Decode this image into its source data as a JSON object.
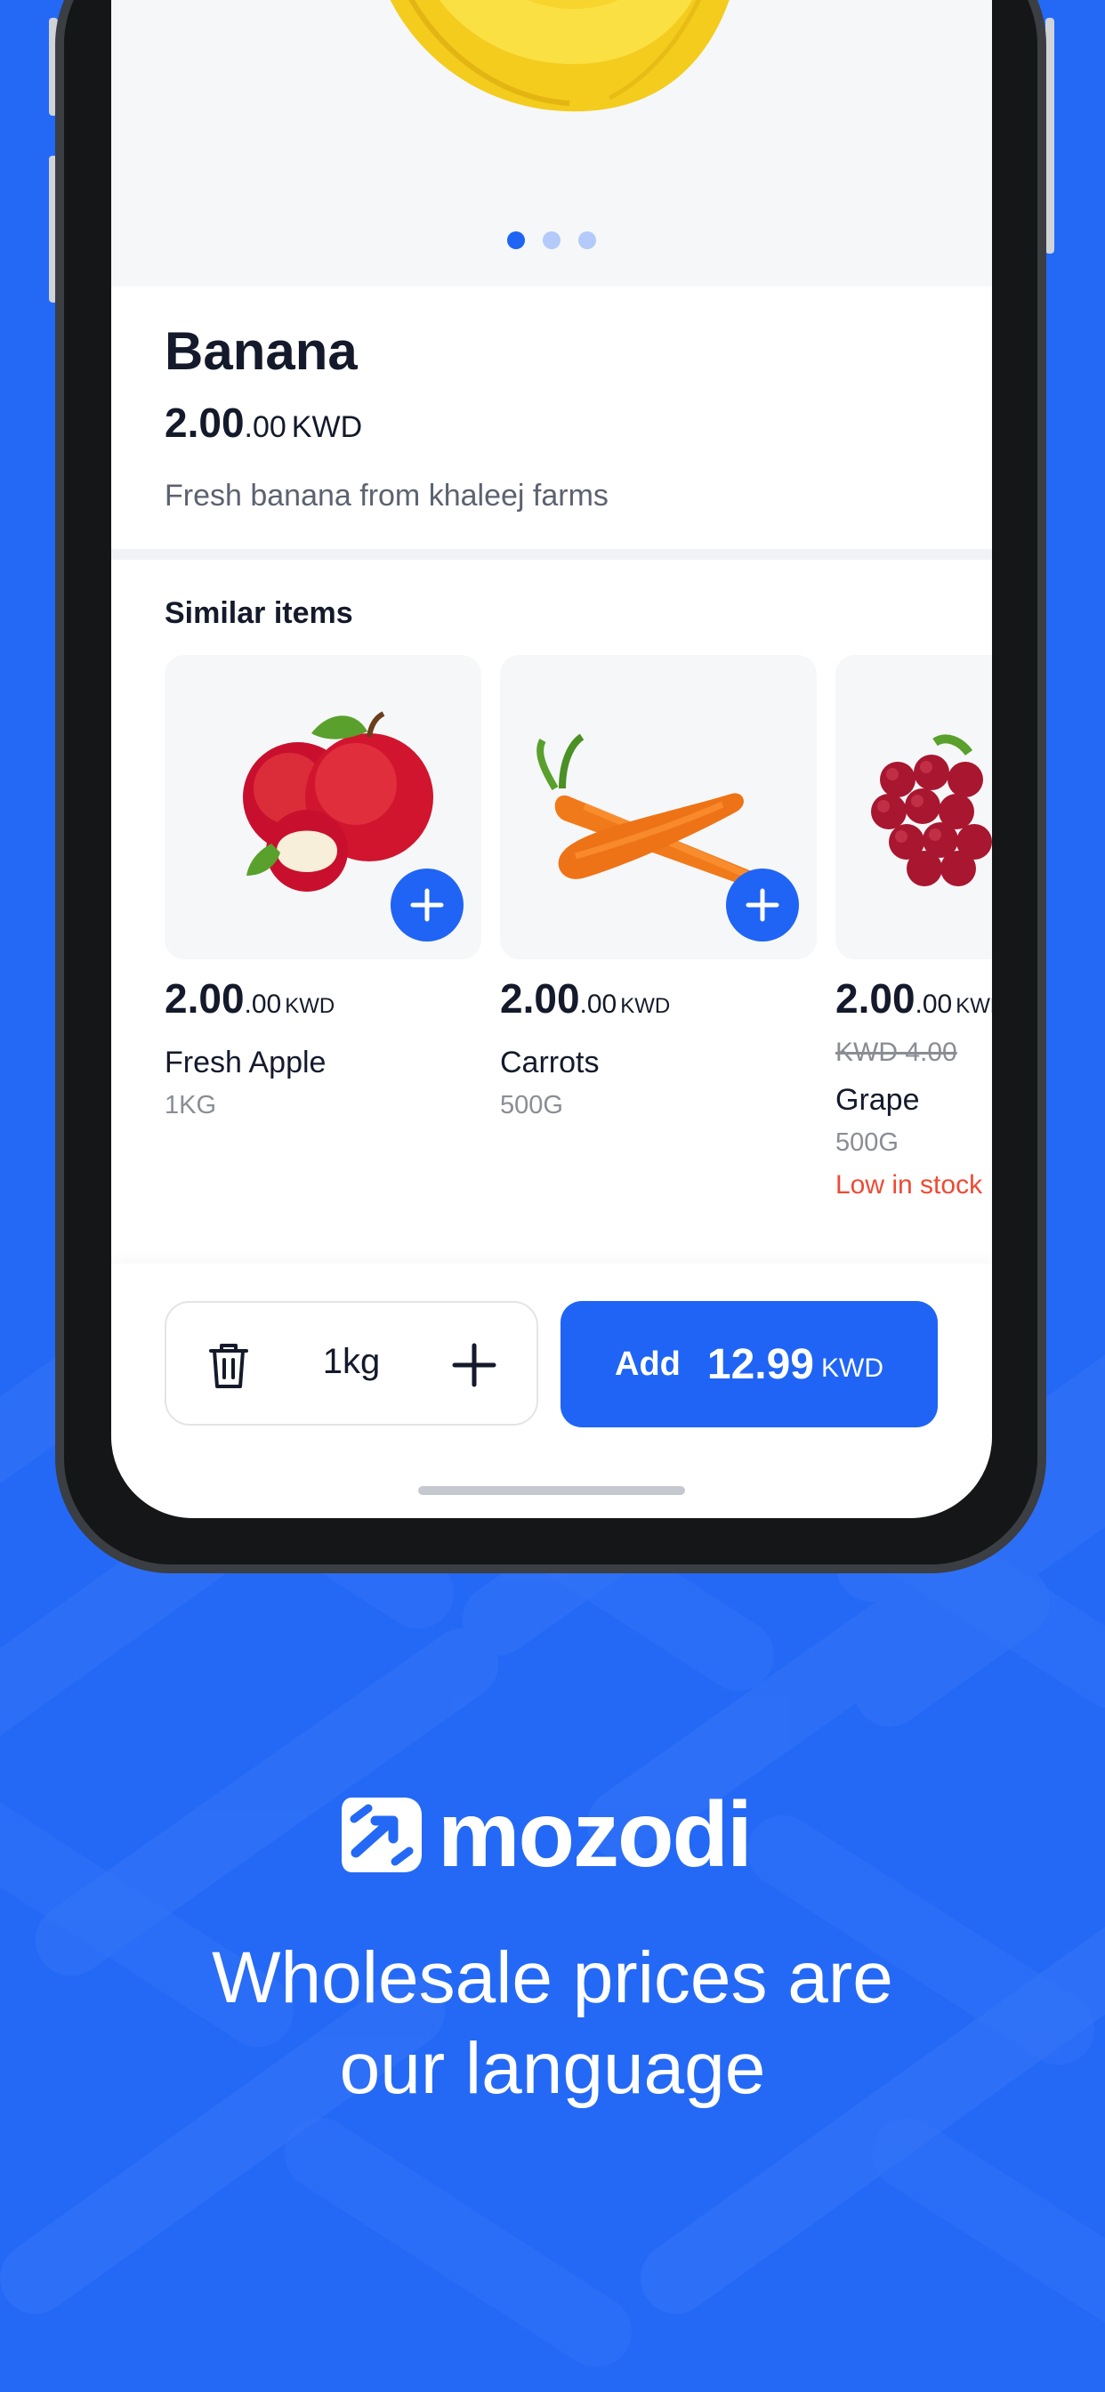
{
  "product": {
    "name": "Banana",
    "price_main": "2.00",
    "price_decimal": ".00",
    "currency": "KWD",
    "description": "Fresh banana from khaleej farms"
  },
  "image_dots": {
    "count": 3,
    "active_index": 0
  },
  "similar": {
    "title": "Similar items",
    "items": [
      {
        "name": "Fresh Apple",
        "price_main": "2.00",
        "price_decimal": ".00",
        "currency": "KWD",
        "unit": "1KG"
      },
      {
        "name": "Carrots",
        "price_main": "2.00",
        "price_decimal": ".00",
        "currency": "KWD",
        "unit": "500G"
      },
      {
        "name": "Grape",
        "price_main": "2.00",
        "price_decimal": ".00",
        "currency": "KWD",
        "old_price": "KWD 4.00",
        "unit": "500G",
        "stock": "Low in stock"
      }
    ]
  },
  "cart_bar": {
    "quantity": "1kg",
    "add_label": "Add",
    "total": "12.99",
    "currency": "KWD"
  },
  "brand": {
    "name": "mozodi",
    "tagline_line1": "Wholesale prices are",
    "tagline_line2": "our language"
  },
  "colors": {
    "background": "#2469f6",
    "accent": "#1f64f5",
    "stock_warning": "#ef4a33"
  }
}
